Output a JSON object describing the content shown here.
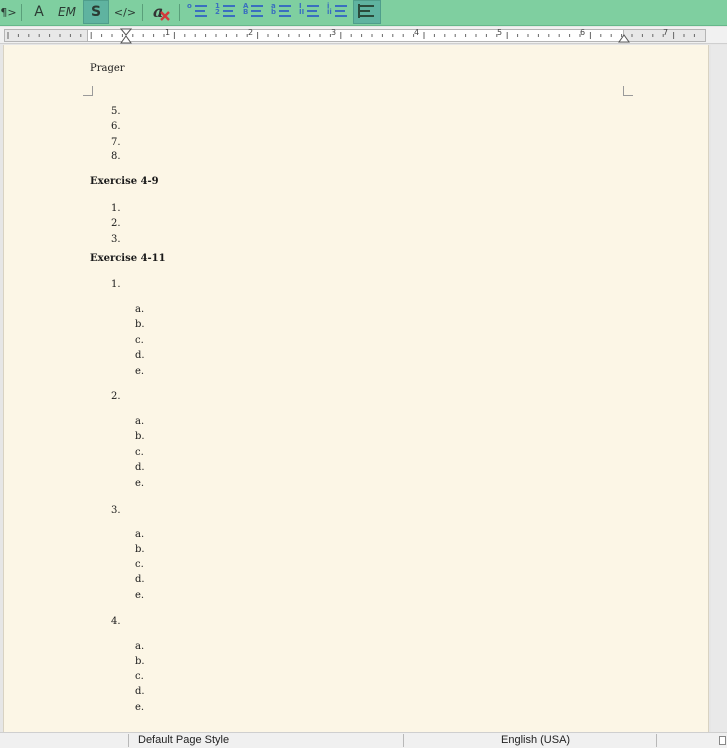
{
  "toolbar": {
    "paragraph_label": "¶>",
    "char_a_label": "A",
    "em_label": "EM",
    "strong_label": "S",
    "code_label": "</>",
    "list_markers": {
      "bullet_o": "o",
      "numbered": "1\n2",
      "upper_alpha": "A\nB",
      "lower_alpha": "a\nb",
      "upper_roman": "I\nII",
      "lower_roman": "i\nii"
    }
  },
  "ruler": {
    "numbers": [
      "1",
      "2",
      "3",
      "4",
      "5",
      "6",
      "7"
    ]
  },
  "document": {
    "header": "Prager",
    "block1": [
      "5.",
      "6.",
      "7.",
      "8."
    ],
    "exercise_a": "Exercise 4-9",
    "block2": [
      "1.",
      "2.",
      "3."
    ],
    "exercise_b": "Exercise 4-11",
    "groups": [
      {
        "num": "1.",
        "sub": [
          "a.",
          "b.",
          "c.",
          "d.",
          "e."
        ]
      },
      {
        "num": "2.",
        "sub": [
          "a.",
          "b.",
          "c.",
          "d.",
          "e."
        ]
      },
      {
        "num": "3.",
        "sub": [
          "a.",
          "b.",
          "c.",
          "d.",
          "e."
        ]
      },
      {
        "num": "4.",
        "sub": [
          "a.",
          "b.",
          "c.",
          "d.",
          "e."
        ]
      }
    ]
  },
  "statusbar": {
    "page_style": "Default Page Style",
    "language": "English (USA)"
  }
}
